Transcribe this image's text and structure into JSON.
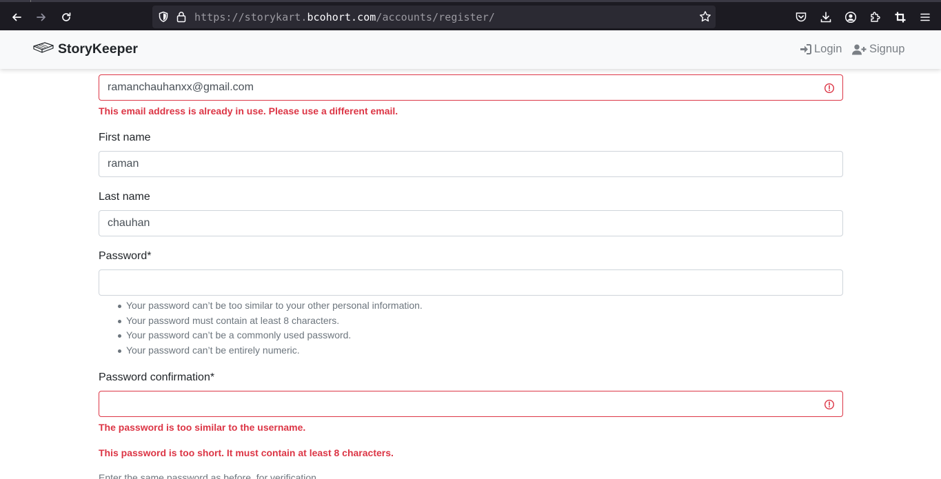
{
  "browser": {
    "url_prefix": "https://storykart.",
    "url_domain": "bcohort.com",
    "url_path": "/accounts/register/"
  },
  "navbar": {
    "brand": "StoryKeeper",
    "login_label": "Login",
    "signup_label": "Signup"
  },
  "form": {
    "email_value": "ramanchauhanxx@gmail.com",
    "email_error": "This email address is already in use. Please use a different email.",
    "first_name_label": "First name",
    "first_name_value": "raman",
    "last_name_label": "Last name",
    "last_name_value": "chauhan",
    "password_label": "Password*",
    "password_value": "",
    "password_help": [
      "Your password can’t be too similar to your other personal information.",
      "Your password must contain at least 8 characters.",
      "Your password can’t be a commonly used password.",
      "Your password can’t be entirely numeric."
    ],
    "password_confirm_label": "Password confirmation*",
    "password_confirm_value": "",
    "password_confirm_errors": [
      "The password is too similar to the username.",
      "This password is too short. It must contain at least 8 characters."
    ],
    "password_confirm_help": "Enter the same password as before, for verification."
  },
  "colors": {
    "error": "#dc3545",
    "navbar_bg": "#f8f9fa",
    "browser_bg": "#1c1b22"
  }
}
